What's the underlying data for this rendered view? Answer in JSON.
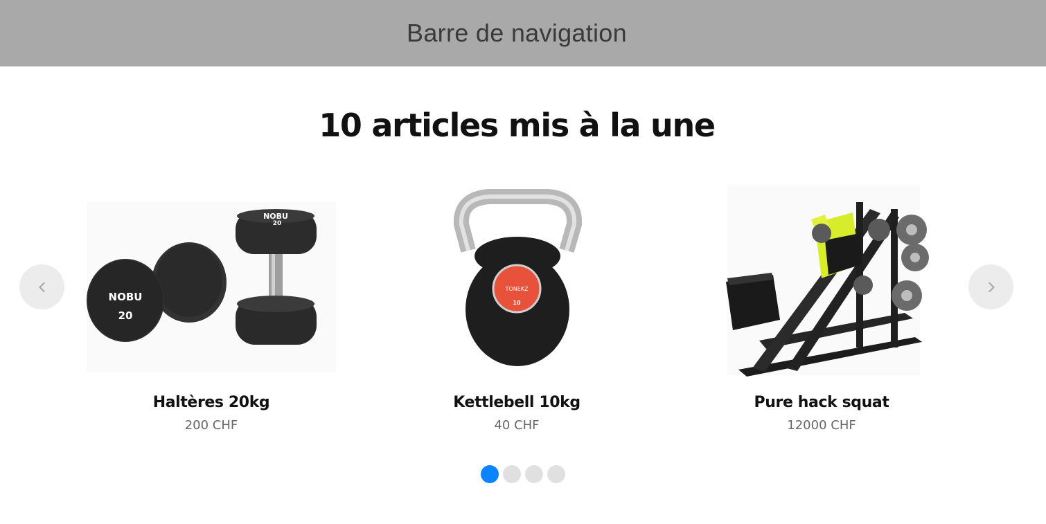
{
  "navbar": {
    "title": "Barre de navigation"
  },
  "featured": {
    "title": "10 articles mis à la une",
    "products": [
      {
        "name": "Haltères 20kg",
        "price": "200 CHF",
        "image_labels": [
          "NOBU",
          "20",
          "NOBU",
          "20"
        ]
      },
      {
        "name": "Kettlebell 10kg",
        "price": "40 CHF",
        "image_labels": [
          "TONEKZ",
          "10"
        ]
      },
      {
        "name": "Pure hack squat",
        "price": "12000 CHF"
      }
    ]
  },
  "carousel": {
    "pages": 4,
    "active_page": 1,
    "prev_icon": "chevron-left-icon",
    "next_icon": "chevron-right-icon"
  },
  "colors": {
    "navbar_bg": "#a9a9a9",
    "active_dot": "#0a84ff",
    "inactive_dot": "#e0e0e0",
    "arrow_bg": "#ececec"
  }
}
